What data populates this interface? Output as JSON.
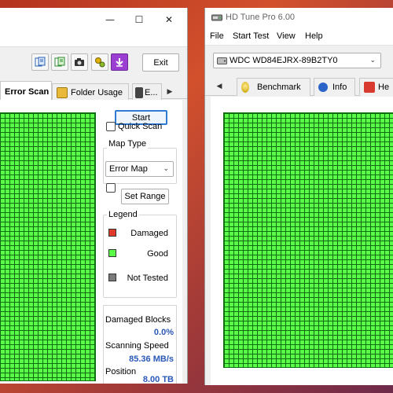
{
  "left_window": {
    "caption": {
      "minimize": "—",
      "maximize": "☐",
      "close": "✕"
    },
    "toolbar": {
      "icons": [
        "copy-text-icon",
        "copy-info-icon",
        "screenshot-icon",
        "options-icon",
        "save-icon"
      ],
      "exit_label": "Exit"
    },
    "tabs": [
      {
        "label": "Error Scan",
        "active": true
      },
      {
        "label": "Folder Usage",
        "active": false
      },
      {
        "label": "E...",
        "active": false
      }
    ],
    "tab_scroll_right": "▶",
    "start_label": "Start",
    "quick_scan_label": "Quick Scan",
    "map_type": {
      "title": "Map Type",
      "selected": "Error Map"
    },
    "set_range_label": "Set Range",
    "legend": {
      "title": "Legend",
      "items": [
        {
          "label": "Damaged",
          "color": "#e03a2a"
        },
        {
          "label": "Good",
          "color": "#5aff4a"
        },
        {
          "label": "Not Tested",
          "color": "#7a7a7a"
        }
      ]
    },
    "stats": {
      "damaged_blocks_label": "Damaged Blocks",
      "damaged_blocks_value": "0.0%",
      "scanning_speed_label": "Scanning Speed",
      "scanning_speed_value": "85.36 MB/s",
      "position_label": "Position",
      "position_value": "8.00 TB"
    }
  },
  "right_window": {
    "title": "HD Tune Pro 6.00",
    "menu": [
      "File",
      "Start Test",
      "View",
      "Help"
    ],
    "drive": "WDC WD84EJRX-89B2TY0",
    "tab_scroll_left": "◀",
    "tabs": [
      {
        "label": "Benchmark"
      },
      {
        "label": "Info"
      },
      {
        "label": "He"
      }
    ]
  },
  "colors": {
    "good_block": "#5aff4a",
    "grid_line": "#0f6e0f",
    "stat_value": "#2a58b8"
  }
}
